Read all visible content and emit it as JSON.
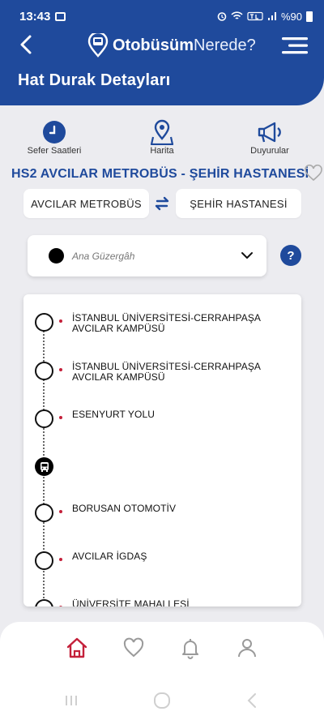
{
  "status": {
    "time": "13:43",
    "battery": "%90"
  },
  "app": {
    "brand_bold": "Otobüsüm",
    "brand_light": "Nerede?"
  },
  "page": {
    "title": "Hat Durak Detayları"
  },
  "actions": [
    {
      "label": "Sefer Saatleri",
      "icon": "clock-icon"
    },
    {
      "label": "Harita",
      "icon": "map-pin-icon"
    },
    {
      "label": "Duyurular",
      "icon": "megaphone-icon"
    }
  ],
  "line": {
    "title": "HS2  AVCILAR METROBÜS - ŞEHİR HASTANESİ"
  },
  "direction": {
    "from": "AVCILAR METROBÜS",
    "to": "ŞEHİR HASTANESİ"
  },
  "route": {
    "selected": "Ana Güzergâh"
  },
  "help_label": "?",
  "stops": [
    {
      "name": "İSTANBUL ÜNİVERSİTESİ-CERRAHPAŞA AVCILAR KAMPÜSÜ"
    },
    {
      "name": "İSTANBUL ÜNİVERSİTESİ-CERRAHPAŞA AVCILAR KAMPÜSÜ"
    },
    {
      "name": "ESENYURT YOLU"
    },
    {
      "name": "BORUSAN OTOMOTİV"
    },
    {
      "name": "AVCILAR İGDAŞ"
    },
    {
      "name": "ÜNİVERSİTE MAHALLESİ"
    }
  ],
  "colors": {
    "primary": "#1f4a9c",
    "accent_red": "#c4203a"
  }
}
